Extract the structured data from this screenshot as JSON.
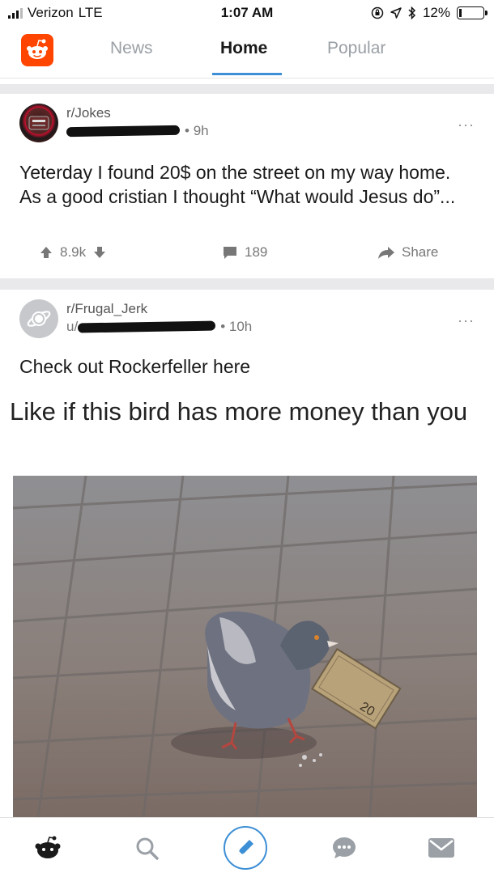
{
  "status_bar": {
    "carrier": "Verizon",
    "network": "LTE",
    "time": "1:07 AM",
    "battery": "12%",
    "battery_level": 0.12
  },
  "header": {
    "logo_icon": "reddit-alien-icon",
    "tabs": [
      {
        "label": "News",
        "active": false
      },
      {
        "label": "Home",
        "active": true
      },
      {
        "label": "Popular",
        "active": false
      }
    ]
  },
  "posts": [
    {
      "subreddit": "r/Jokes",
      "age": "9h",
      "title": "Yeterday I found 20$ on the street on my way home. As a good cristian I thought “What would Jesus do”...",
      "upvotes": "8.9k",
      "comments": "189",
      "share_label": "Share",
      "more_label": "···"
    },
    {
      "subreddit": "r/Frugal_Jerk",
      "author_prefix": "u/",
      "age": "10h",
      "title": "Check out Rockerfeller here",
      "more_label": "···",
      "image": {
        "caption": "Like if this bird has more money than you",
        "note_text": "20"
      }
    }
  ],
  "bottom_nav": [
    {
      "icon": "reddit-home-icon"
    },
    {
      "icon": "search-icon"
    },
    {
      "icon": "compose-icon"
    },
    {
      "icon": "chat-icon"
    },
    {
      "icon": "mail-icon"
    }
  ],
  "colors": {
    "brand": "#ff4500",
    "accent": "#3d8fd6",
    "muted": "#9aa0a6"
  }
}
